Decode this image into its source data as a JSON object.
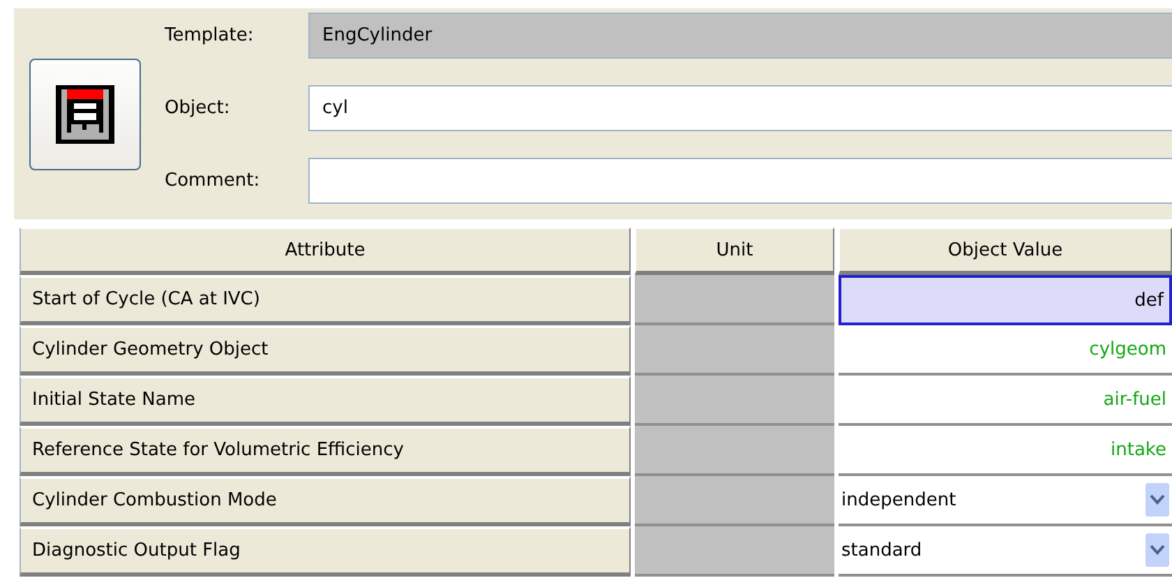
{
  "header": {
    "fields": [
      {
        "label": "Template:",
        "value": "EngCylinder",
        "disabled": true
      },
      {
        "label": "Object:",
        "value": "cyl",
        "disabled": false
      },
      {
        "label": "Comment:",
        "disabled": false
      }
    ]
  },
  "table": {
    "columns": [
      "Attribute",
      "Unit",
      "Object Value"
    ],
    "rows": [
      {
        "attribute": "Start of Cycle (CA at IVC)",
        "kind": "text",
        "value": "def",
        "color": "#000000",
        "selected": true
      },
      {
        "attribute": "Cylinder Geometry Object",
        "kind": "text",
        "value": "cylgeom",
        "color": "#13a813",
        "selected": false
      },
      {
        "attribute": "Initial State Name",
        "kind": "text",
        "value": "air-fuel",
        "color": "#13a813",
        "selected": false
      },
      {
        "attribute": "Reference State for Volumetric Efficiency",
        "kind": "text",
        "value": "intake",
        "color": "#13a813",
        "selected": false
      },
      {
        "attribute": "Cylinder Combustion Mode",
        "kind": "dropdown",
        "value": "independent",
        "color": "#000000",
        "selected": false
      },
      {
        "attribute": "Diagnostic Output Flag",
        "kind": "dropdown",
        "value": "standard",
        "color": "#000000",
        "selected": false
      }
    ]
  }
}
